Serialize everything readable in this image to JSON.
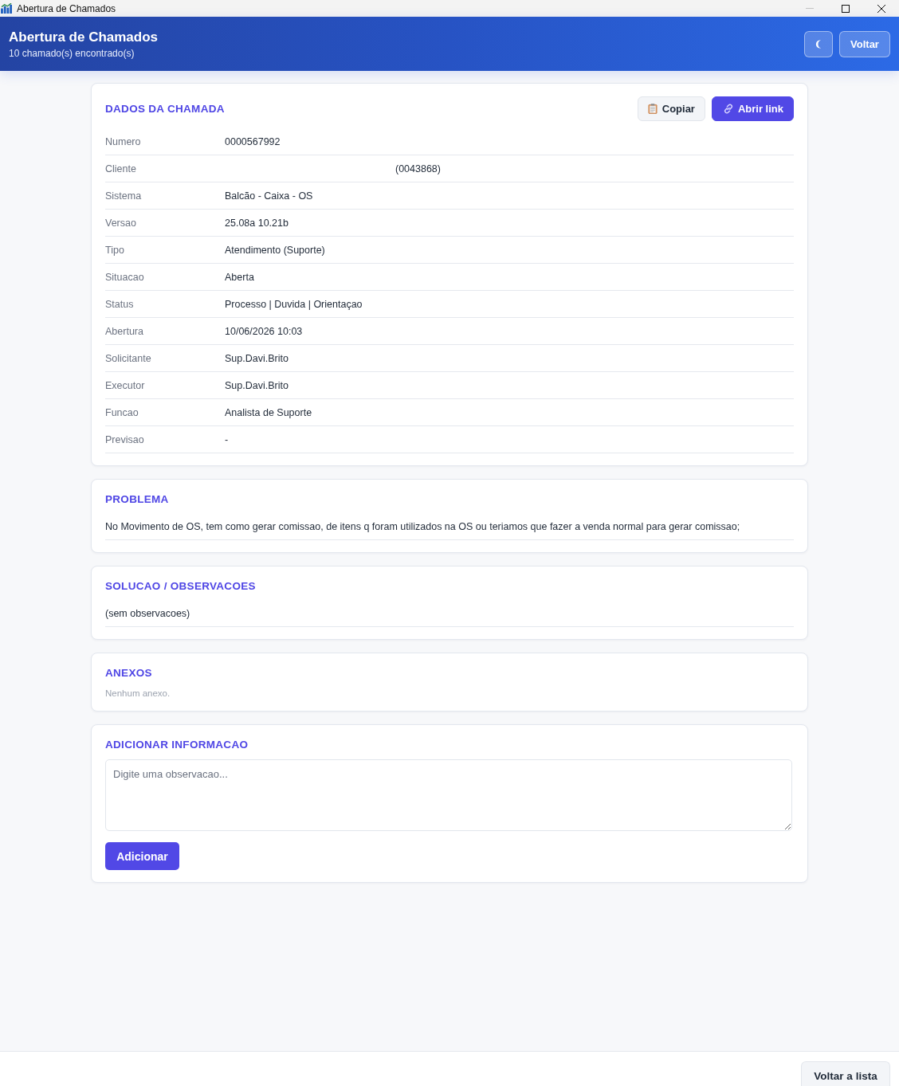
{
  "window": {
    "title": "Abertura de Chamados"
  },
  "header": {
    "title": "Abertura de Chamados",
    "subtitle": "10 chamado(s) encontrado(s)",
    "back_button": "Voltar"
  },
  "details": {
    "title": "DADOS DA CHAMADA",
    "actions": [
      {
        "kind": "secondary",
        "label": "Copiar"
      },
      {
        "kind": "primary",
        "label": "Abrir link"
      }
    ],
    "rows": [
      {
        "kind": "text",
        "label": "Numero",
        "value": "0000567992"
      },
      {
        "kind": "masked",
        "label": "Cliente",
        "value": "(0043868)"
      },
      {
        "kind": "text",
        "label": "Sistema",
        "value": "Balcão - Caixa - OS"
      },
      {
        "kind": "text",
        "label": "Versao",
        "value": "25.08a 10.21b"
      },
      {
        "kind": "text",
        "label": "Tipo",
        "value": "Atendimento (Suporte)"
      },
      {
        "kind": "text",
        "label": "Situacao",
        "value": "Aberta"
      },
      {
        "kind": "text",
        "label": "Status",
        "value": "Processo | Duvida | Orientaçao"
      },
      {
        "kind": "text",
        "label": "Abertura",
        "value": "10/06/2026 10:03"
      },
      {
        "kind": "text",
        "label": "Solicitante",
        "value": "Sup.Davi.Brito"
      },
      {
        "kind": "text",
        "label": "Executor",
        "value": "Sup.Davi.Brito"
      },
      {
        "kind": "text",
        "label": "Funcao",
        "value": "Analista de Suporte"
      },
      {
        "kind": "text",
        "label": "Previsao",
        "value": "-"
      }
    ]
  },
  "problem": {
    "title": "PROBLEMA",
    "text": "No Movimento de OS, tem como gerar comissao, de itens q foram utilizados na OS ou teriamos que fazer a venda normal para gerar comissao;"
  },
  "solution": {
    "title": "SOLUCAO / OBSERVACOES",
    "text": "(sem observacoes)"
  },
  "attachments": {
    "title": "ANEXOS",
    "empty_text": "Nenhum anexo."
  },
  "add_info": {
    "title": "ADICIONAR INFORMACAO",
    "placeholder": "Digite uma observacao...",
    "button": "Adicionar"
  },
  "footer": {
    "button": "Voltar a lista"
  }
}
